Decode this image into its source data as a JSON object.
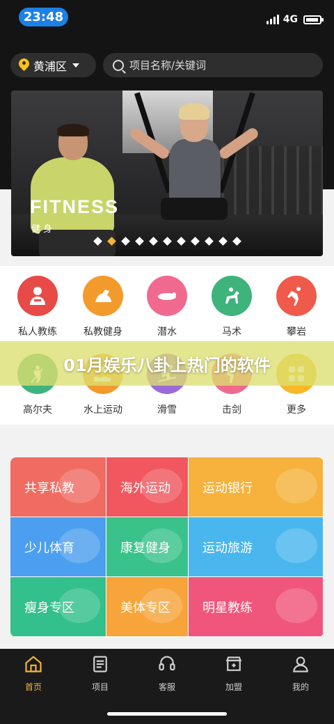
{
  "status": {
    "time": "23:48",
    "network": "4G"
  },
  "header": {
    "location": "黄浦区",
    "search_placeholder": "项目名称/关键词"
  },
  "banner": {
    "title": "FITNESS",
    "subtitle": "健身",
    "slide_count": 11,
    "active_index": 1
  },
  "categories": [
    {
      "label": "私人教练",
      "icon": "trainer-icon",
      "color": "#e84a47"
    },
    {
      "label": "私教健身",
      "icon": "muscle-arm-icon",
      "color": "#f39a2d"
    },
    {
      "label": "潜水",
      "icon": "diving-icon",
      "color": "#f06a8f"
    },
    {
      "label": "马术",
      "icon": "horse-riding-icon",
      "color": "#3fb37c"
    },
    {
      "label": "攀岩",
      "icon": "rock-climbing-icon",
      "color": "#ef5a4b"
    },
    {
      "label": "高尔夫",
      "icon": "golf-icon",
      "color": "#3fb37c"
    },
    {
      "label": "水上运动",
      "icon": "water-sports-icon",
      "color": "#f39a2d"
    },
    {
      "label": "滑雪",
      "icon": "skiing-icon",
      "color": "#9b6ad8"
    },
    {
      "label": "击剑",
      "icon": "fencing-icon",
      "color": "#f06a8f"
    },
    {
      "label": "更多",
      "icon": "more-grid-icon",
      "color": "#f7b928"
    }
  ],
  "overlay_text": "01月娱乐八卦上热门的软件",
  "services": [
    {
      "label": "共享私教",
      "color": "#f06b62"
    },
    {
      "label": "海外运动",
      "color": "#f0575e"
    },
    {
      "label": "运动银行",
      "color": "#f6b23c"
    },
    {
      "label": "少儿体育",
      "color": "#4c9ff0"
    },
    {
      "label": "康复健身",
      "color": "#39c28a"
    },
    {
      "label": "运动旅游",
      "color": "#4ab6ee"
    },
    {
      "label": "瘦身专区",
      "color": "#33c08c"
    },
    {
      "label": "美体专区",
      "color": "#f7a43a"
    },
    {
      "label": "明星教练",
      "color": "#f0567b"
    }
  ],
  "tabs": [
    {
      "label": "首页",
      "icon": "home-icon",
      "active": true
    },
    {
      "label": "项目",
      "icon": "project-list-icon",
      "active": false
    },
    {
      "label": "客服",
      "icon": "headset-icon",
      "active": false
    },
    {
      "label": "加盟",
      "icon": "join-store-icon",
      "active": false
    },
    {
      "label": "我的",
      "icon": "profile-icon",
      "active": false
    }
  ],
  "colors": {
    "accent": "#f2b43a",
    "time_pill": "#1d80e6",
    "dark_bg": "#141414"
  }
}
